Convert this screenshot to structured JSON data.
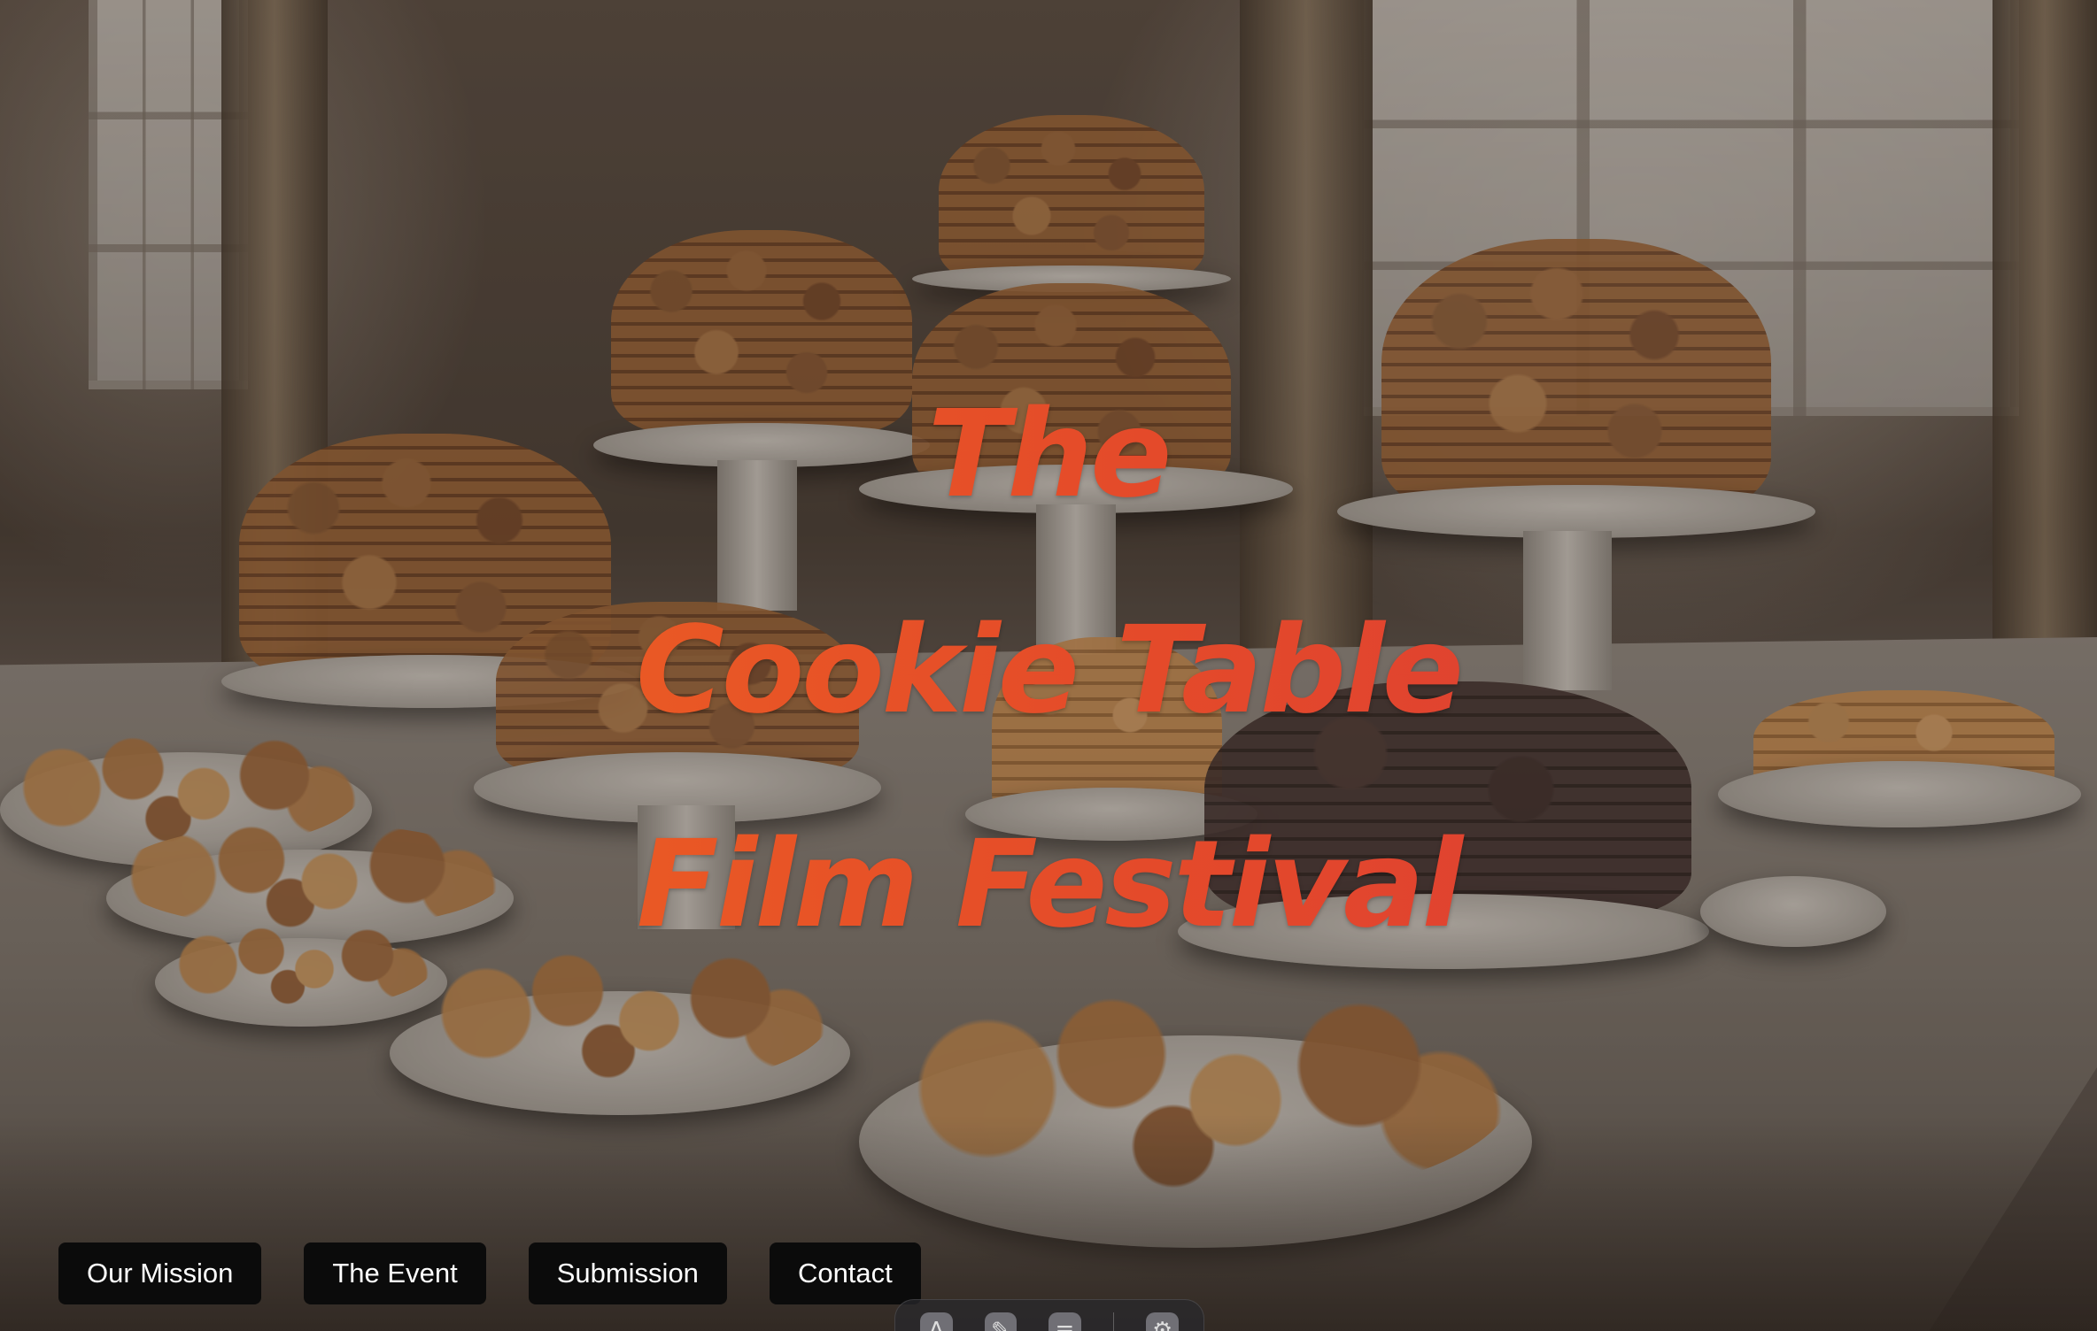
{
  "hero": {
    "title_line1": "The",
    "title_line2": "Cookie Table",
    "title_line3": "Film Festival",
    "background_image": "cookie-table-photo",
    "title_gradient": [
      "#f06a1e",
      "#d9363a"
    ]
  },
  "nav": {
    "items": [
      {
        "label": "Our Mission"
      },
      {
        "label": "The Event"
      },
      {
        "label": "Submission"
      },
      {
        "label": "Contact"
      }
    ],
    "button_bg": "#0b0b0b",
    "button_text_color": "#ffffff"
  },
  "dock": {
    "icons": [
      "text-icon",
      "pen-icon",
      "list-icon",
      "settings-icon"
    ]
  }
}
